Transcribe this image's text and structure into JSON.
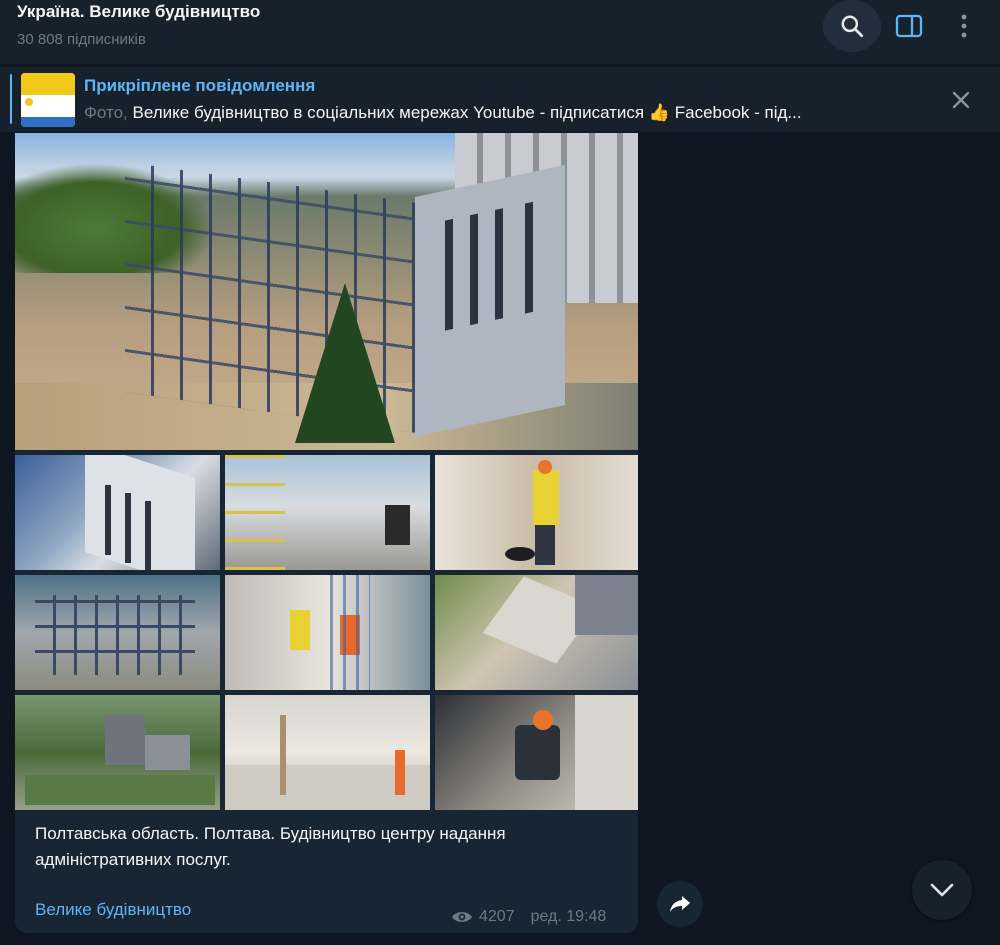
{
  "header": {
    "title": "Україна. Велике будівництво",
    "subscribers": "30 808 підписників"
  },
  "pinned": {
    "title": "Прикріплене повідомлення",
    "prefix": "Фото,",
    "text": "Велике будівництво в соціальних мережах  Youtube - підписатися 👍 Facebook - під..."
  },
  "message": {
    "caption": "Полтавська область. Полтава. Будівництво центру надання адміністративних послуг.",
    "signature": "Велике будівництво",
    "views": "4207",
    "edited_time": "ред. 19:48"
  },
  "icons": {
    "search": "search-icon",
    "panel": "sidebar-toggle-icon",
    "more": "more-vertical-icon",
    "close": "close-icon",
    "views": "eye-icon",
    "share": "share-icon",
    "scroll": "chevron-down-icon"
  },
  "colors": {
    "background": "#0e1621",
    "panel": "#17212b",
    "bubble": "#182533",
    "accent": "#5eb5f7",
    "muted": "#6d7883"
  }
}
